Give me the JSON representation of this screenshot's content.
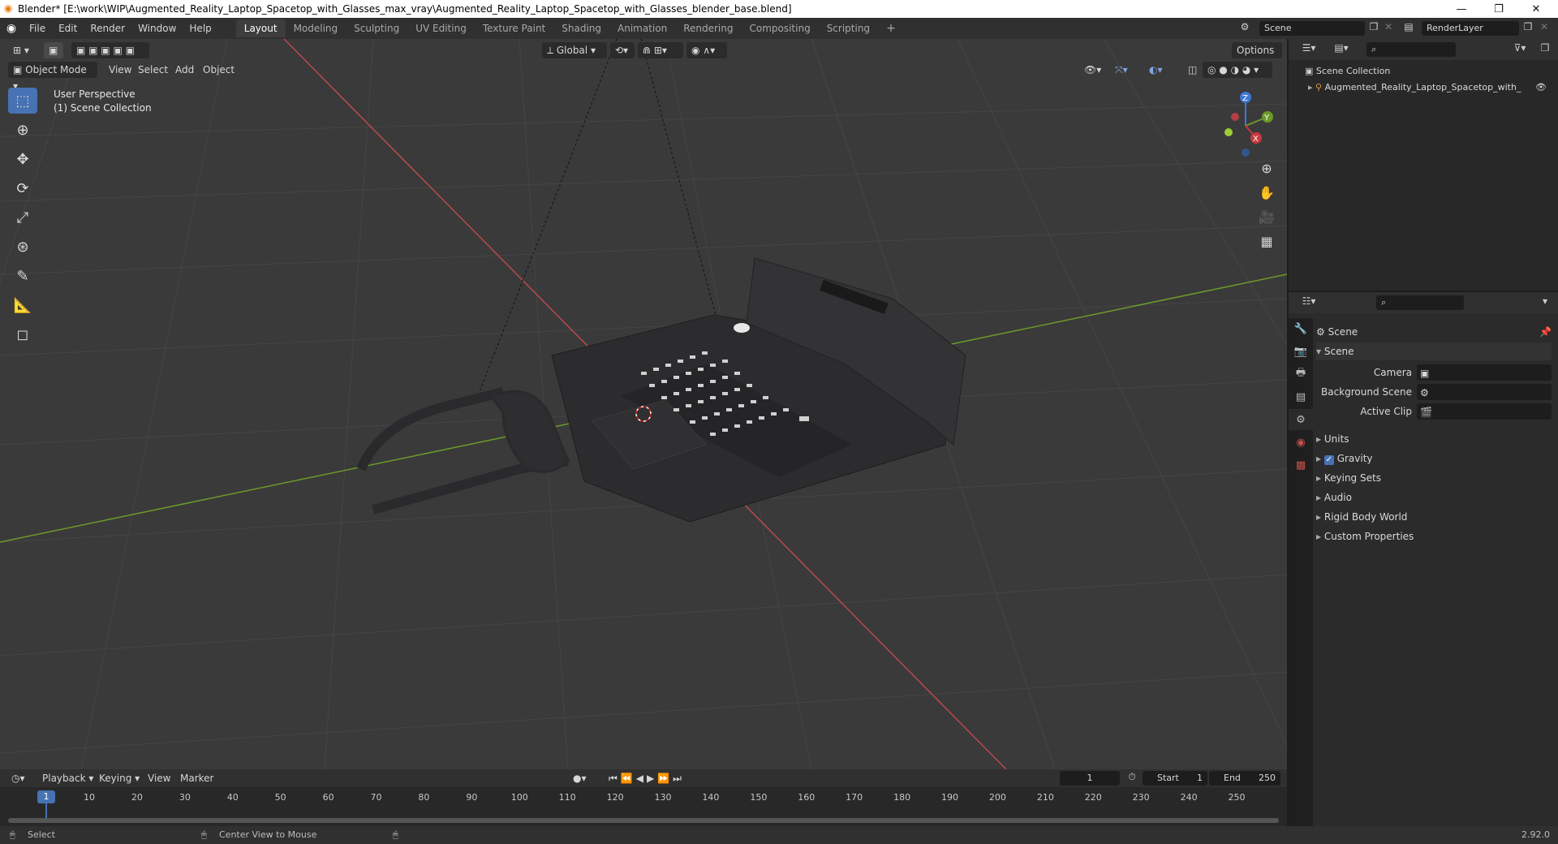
{
  "window": {
    "title": "Blender* [E:\\work\\WIP\\Augmented_Reality_Laptop_Spacetop_with_Glasses_max_vray\\Augmented_Reality_Laptop_Spacetop_with_Glasses_blender_base.blend]",
    "minimize": "—",
    "restore": "❐",
    "close": "✕"
  },
  "menu": [
    "File",
    "Edit",
    "Render",
    "Window",
    "Help"
  ],
  "workspaces": [
    {
      "label": "Layout",
      "active": true
    },
    {
      "label": "Modeling"
    },
    {
      "label": "Sculpting"
    },
    {
      "label": "UV Editing"
    },
    {
      "label": "Texture Paint"
    },
    {
      "label": "Shading"
    },
    {
      "label": "Animation"
    },
    {
      "label": "Rendering"
    },
    {
      "label": "Compositing"
    },
    {
      "label": "Scripting"
    },
    {
      "label": "+"
    }
  ],
  "scene_selector": "Scene",
  "render_layer": "RenderLayer",
  "viewport": {
    "mode": "Object Mode",
    "menus": [
      "View",
      "Select",
      "Add",
      "Object"
    ],
    "transform_orientation": "Global",
    "options": "Options",
    "perspective": "User Perspective",
    "collection": "(1) Scene Collection",
    "gizmo_axes": {
      "x": "X",
      "y": "Y",
      "z": "Z"
    }
  },
  "outliner": {
    "root": "Scene Collection",
    "item": "Augmented_Reality_Laptop_Spacetop_with_"
  },
  "properties": {
    "header": "Scene",
    "panel": "Scene",
    "camera_label": "Camera",
    "background_label": "Background Scene",
    "clip_label": "Active Clip",
    "sections": [
      "Units",
      "Gravity",
      "Keying Sets",
      "Audio",
      "Rigid Body World",
      "Custom Properties"
    ]
  },
  "timeline": {
    "menus": [
      "Playback",
      "Keying",
      "View",
      "Marker"
    ],
    "current_frame": "1",
    "start_label": "Start",
    "start": "1",
    "end_label": "End",
    "end": "250",
    "ticks": [
      "1",
      "10",
      "20",
      "30",
      "40",
      "50",
      "60",
      "70",
      "80",
      "90",
      "100",
      "110",
      "120",
      "130",
      "140",
      "150",
      "160",
      "170",
      "180",
      "190",
      "200",
      "210",
      "220",
      "230",
      "240",
      "250"
    ]
  },
  "status": {
    "select": "Select",
    "center_view": "Center View to Mouse",
    "version": "2.92.0"
  },
  "colors": {
    "accent": "#4772b3",
    "x_axis": "#c8383e",
    "y_axis": "#6c9a29",
    "z_axis": "#3d78d8"
  }
}
